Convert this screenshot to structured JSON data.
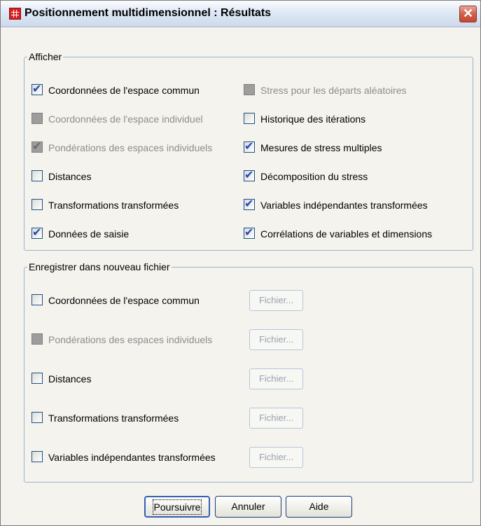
{
  "window": {
    "title": "Positionnement multidimensionnel : Résultats",
    "close_label": "✕"
  },
  "display_group": {
    "legend": "Afficher",
    "left_options": [
      {
        "label": "Coordonnées de l'espace commun",
        "checked": true,
        "enabled": true
      },
      {
        "label": "Coordonnées de l'espace individuel",
        "checked": false,
        "enabled": false
      },
      {
        "label": "Pondérations des espaces individuels",
        "checked": true,
        "enabled": false
      },
      {
        "label": "Distances",
        "checked": false,
        "enabled": true
      },
      {
        "label": "Transformations transformées",
        "checked": false,
        "enabled": true
      },
      {
        "label": "Données de saisie",
        "checked": true,
        "enabled": true
      }
    ],
    "right_options": [
      {
        "label": "Stress pour les départs aléatoires",
        "checked": false,
        "enabled": false
      },
      {
        "label": "Historique des itérations",
        "checked": false,
        "enabled": true
      },
      {
        "label": "Mesures de stress multiples",
        "checked": true,
        "enabled": true
      },
      {
        "label": "Décomposition du stress",
        "checked": true,
        "enabled": true
      },
      {
        "label": "Variables indépendantes transformées",
        "checked": true,
        "enabled": true
      },
      {
        "label": "Corrélations de variables et dimensions",
        "checked": true,
        "enabled": true
      }
    ]
  },
  "save_group": {
    "legend": "Enregistrer dans nouveau fichier",
    "options": [
      {
        "label": "Coordonnées de l'espace commun",
        "checked": false,
        "enabled": true,
        "button": "Fichier..."
      },
      {
        "label": "Pondérations des espaces individuels",
        "checked": false,
        "enabled": false,
        "button": "Fichier..."
      },
      {
        "label": "Distances",
        "checked": false,
        "enabled": true,
        "button": "Fichier..."
      },
      {
        "label": "Transformations transformées",
        "checked": false,
        "enabled": true,
        "button": "Fichier..."
      },
      {
        "label": "Variables indépendantes transformées",
        "checked": false,
        "enabled": true,
        "button": "Fichier..."
      }
    ]
  },
  "buttons": {
    "continue": "Poursuivre",
    "cancel": "Annuler",
    "help": "Aide"
  }
}
